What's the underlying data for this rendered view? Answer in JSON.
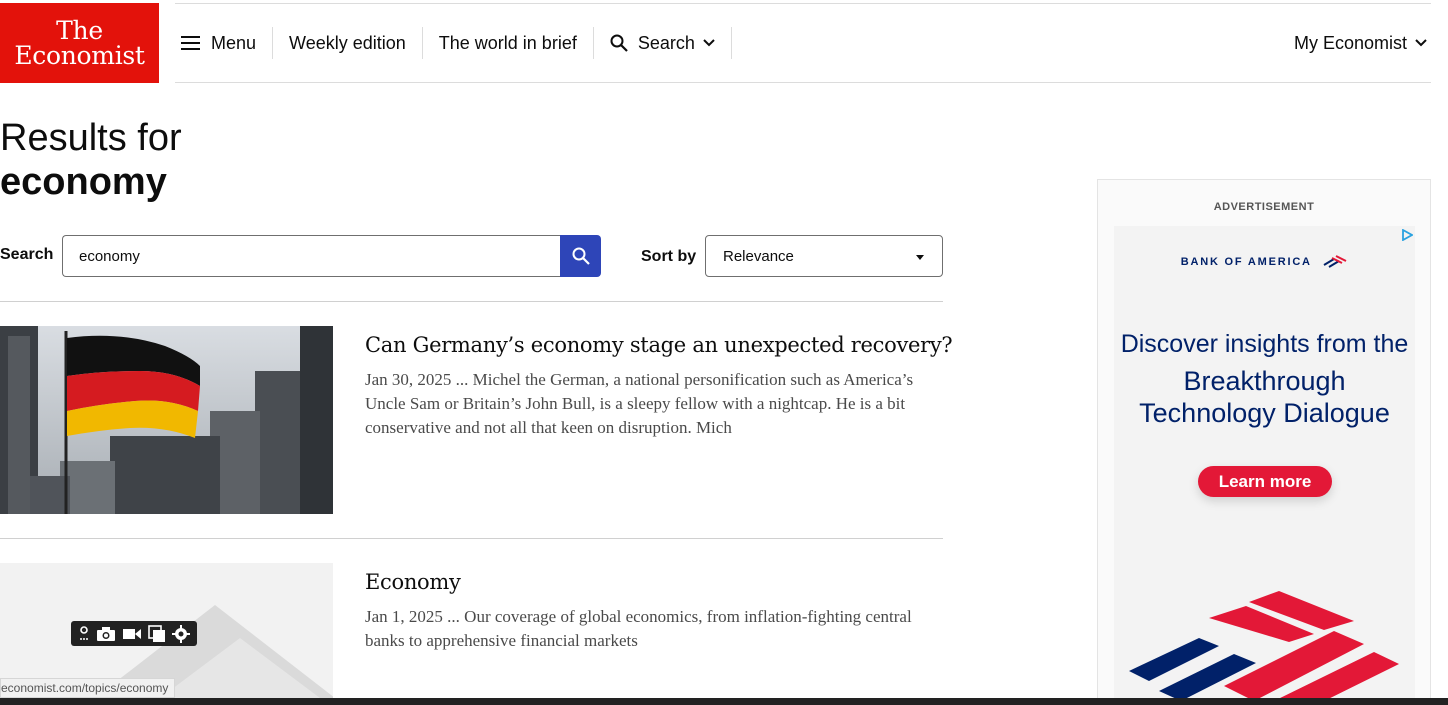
{
  "logo": {
    "line1": "The",
    "line2": "Economist"
  },
  "nav": {
    "menu": "Menu",
    "weekly": "Weekly edition",
    "world_brief": "The world in brief",
    "search": "Search",
    "account": "My Economist"
  },
  "results": {
    "prefix": "Results for",
    "term": "economy"
  },
  "search": {
    "label": "Search",
    "value": "economy",
    "sort_label": "Sort by",
    "sort_value": "Relevance"
  },
  "articles": [
    {
      "title": "Can Germany’s economy stage an unexpected recovery?",
      "snippet": "Jan 30, 2025 ... Michel the German, a national personification such as America’s Uncle Sam or Britain’s John Bull, is a sleepy fellow with a nightcap. He is a bit conservative and not all that keen on disruption. Mich"
    },
    {
      "title": "Economy",
      "snippet": "Jan 1, 2025 ... Our coverage of global economics, from inflation-fighting central banks to apprehensive financial markets"
    }
  ],
  "ad": {
    "label": "ADVERTISEMENT",
    "brand": "BANK OF AMERICA",
    "headline1": "Discover insights from the",
    "headline2": "Breakthrough",
    "headline3": "Technology Dialogue",
    "cta": "Learn more"
  },
  "status_url": "economist.com/topics/economy",
  "colors": {
    "brand_red": "#e3120b",
    "search_blue": "#2e45b8",
    "boa_navy": "#012169",
    "boa_red": "#e31837"
  }
}
